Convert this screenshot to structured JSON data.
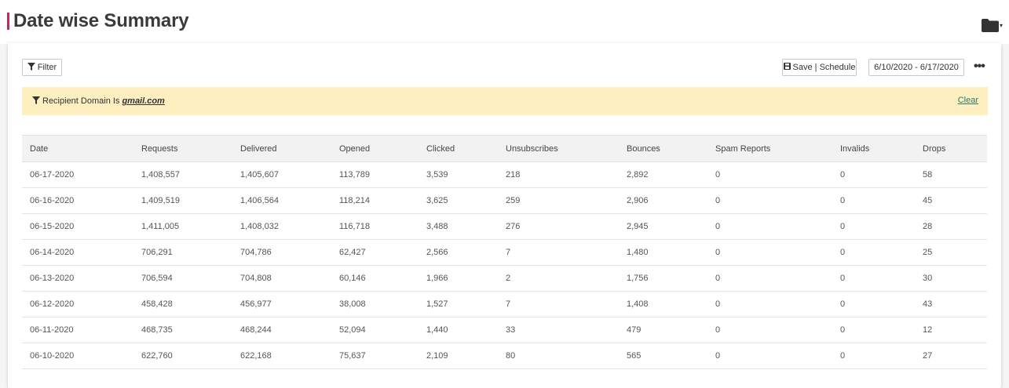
{
  "header": {
    "title": "Date wise Summary",
    "accent_color": "#c8255a",
    "folder_icon": "folder-icon"
  },
  "toolbar": {
    "filter_label": "Filter",
    "save_label": "Save | Schedule",
    "date_range": "6/10/2020 - 6/17/2020",
    "more_label": "•••"
  },
  "filter_banner": {
    "text": "Recipient Domain Is",
    "value": "gmail.com",
    "clear_label": "Clear"
  },
  "table": {
    "columns": [
      "Date",
      "Requests",
      "Delivered",
      "Opened",
      "Clicked",
      "Unsubscribes",
      "Bounces",
      "Spam Reports",
      "Invalids",
      "Drops"
    ],
    "rows": [
      [
        "06-17-2020",
        "1,408,557",
        "1,405,607",
        "113,789",
        "3,539",
        "218",
        "2,892",
        "0",
        "0",
        "58"
      ],
      [
        "06-16-2020",
        "1,409,519",
        "1,406,564",
        "118,214",
        "3,625",
        "259",
        "2,906",
        "0",
        "0",
        "45"
      ],
      [
        "06-15-2020",
        "1,411,005",
        "1,408,032",
        "116,718",
        "3,488",
        "276",
        "2,945",
        "0",
        "0",
        "28"
      ],
      [
        "06-14-2020",
        "706,291",
        "704,786",
        "62,427",
        "2,566",
        "7",
        "1,480",
        "0",
        "0",
        "25"
      ],
      [
        "06-13-2020",
        "706,594",
        "704,808",
        "60,146",
        "1,966",
        "2",
        "1,756",
        "0",
        "0",
        "30"
      ],
      [
        "06-12-2020",
        "458,428",
        "456,977",
        "38,008",
        "1,527",
        "7",
        "1,408",
        "0",
        "0",
        "43"
      ],
      [
        "06-11-2020",
        "468,735",
        "468,244",
        "52,094",
        "1,440",
        "33",
        "479",
        "0",
        "0",
        "12"
      ],
      [
        "06-10-2020",
        "622,760",
        "622,168",
        "75,637",
        "2,109",
        "80",
        "565",
        "0",
        "0",
        "27"
      ]
    ]
  }
}
